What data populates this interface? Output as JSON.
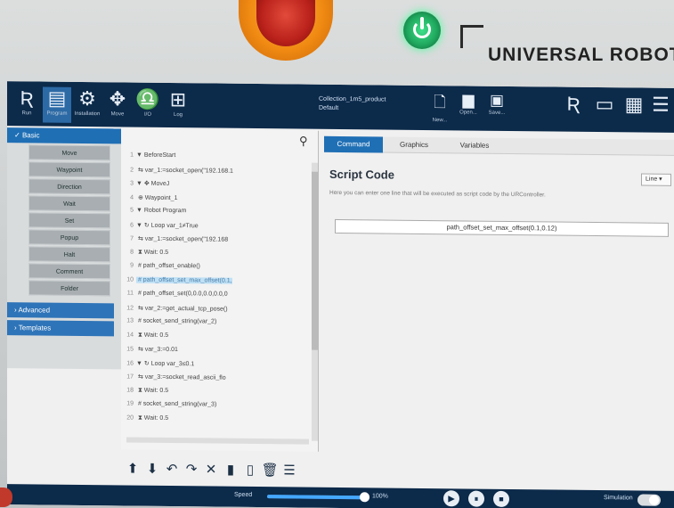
{
  "hardware": {
    "brand": "UNIVERSAL ROBOT"
  },
  "topbar": {
    "icons": [
      {
        "name": "ur-logo-icon",
        "glyph": "Ʀ",
        "label": "Run"
      },
      {
        "name": "program-icon",
        "glyph": "▤",
        "label": "Program"
      },
      {
        "name": "installation-icon",
        "glyph": "⚙",
        "label": "Installation"
      },
      {
        "name": "move-icon",
        "glyph": "✥",
        "label": "Move"
      },
      {
        "name": "io-icon",
        "glyph": "♎",
        "label": "I/O"
      },
      {
        "name": "log-icon",
        "glyph": "⊞",
        "label": "Log"
      }
    ],
    "file_name": "Collection_1m5_product",
    "file_sub": "Default",
    "file_actions": [
      {
        "name": "new-icon",
        "glyph": "🗋",
        "label": "New..."
      },
      {
        "name": "open-icon",
        "glyph": "▆",
        "label": "Open..."
      },
      {
        "name": "save-icon",
        "glyph": "▣",
        "label": "Save..."
      }
    ]
  },
  "nav": {
    "basic": "Basic",
    "items": [
      "Move",
      "Waypoint",
      "Direction",
      "Wait",
      "Set",
      "Popup",
      "Halt",
      "Comment",
      "Folder"
    ],
    "groups": [
      "Advanced",
      "Templates"
    ]
  },
  "tree": {
    "lines": [
      {
        "n": "1",
        "t": "▼ BeforeStart",
        "sel": false
      },
      {
        "n": "2",
        "t": "  ⇆ var_1:=socket_open(\"192.168.1",
        "sel": false
      },
      {
        "n": "3",
        "t": "▼ ✥ MoveJ",
        "sel": false
      },
      {
        "n": "4",
        "t": "     ⊕ Waypoint_1",
        "sel": false
      },
      {
        "n": "5",
        "t": "▼ Robot Program",
        "sel": false
      },
      {
        "n": "6",
        "t": "▼ ↻ Loop var_1≠True",
        "sel": false
      },
      {
        "n": "7",
        "t": "     ⇆ var_1:=socket_open(\"192.168",
        "sel": false
      },
      {
        "n": "8",
        "t": "     ⧗ Wait: 0.5",
        "sel": false
      },
      {
        "n": "9",
        "t": "  # path_offset_enable()",
        "sel": false
      },
      {
        "n": "10",
        "t": "  # path_offset_set_max_offset(0.1,",
        "sel": true
      },
      {
        "n": "11",
        "t": "  # path_offset_set(0,0.0,0.0,0.0,0",
        "sel": false
      },
      {
        "n": "12",
        "t": "  ⇆ var_2:=get_actual_tcp_pose()",
        "sel": false
      },
      {
        "n": "13",
        "t": "  # socket_send_string(var_2)",
        "sel": false
      },
      {
        "n": "14",
        "t": "  ⧗ Wait: 0.5",
        "sel": false
      },
      {
        "n": "15",
        "t": "  ⇆ var_3:=0.01",
        "sel": false
      },
      {
        "n": "16",
        "t": "▼ ↻ Loop var_3≤0.1",
        "sel": false
      },
      {
        "n": "17",
        "t": "     ⇆ var_3:=socket_read_ascii_flo",
        "sel": false
      },
      {
        "n": "18",
        "t": "     ⧗ Wait: 0.5",
        "sel": false
      },
      {
        "n": "19",
        "t": "  # socket_send_string(var_3)",
        "sel": false
      },
      {
        "n": "20",
        "t": "  ⧗ Wait: 0.5",
        "sel": false
      }
    ],
    "tools": [
      "⬆",
      "⬇",
      "↶",
      "↷",
      "✕",
      "▮",
      "▯",
      "🗑",
      "☰"
    ]
  },
  "tabs": [
    "Command",
    "Graphics",
    "Variables"
  ],
  "script": {
    "title": "Script Code",
    "description": "Here you can enter one line that will be executed as script code by the URController.",
    "mode": "Line",
    "code": "path_offset_set_max_offset(0.1,0.12)"
  },
  "footer": {
    "speed_label": "Speed",
    "speed_value": "100%",
    "speed_fraction": 1.0,
    "controls": [
      "▶",
      "⏸",
      "■"
    ],
    "simulation_label": "Simulation"
  },
  "colors": {
    "accent": "#1f6fb5",
    "topbar": "#0c2a4a",
    "selected": "#bfe0f5"
  }
}
